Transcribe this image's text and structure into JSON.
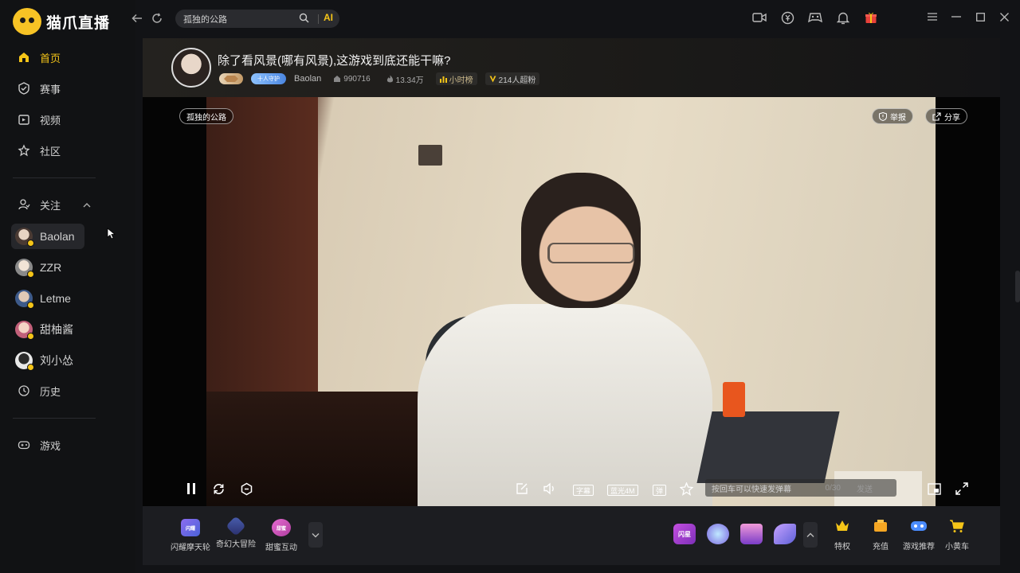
{
  "app": {
    "logo_text": "猫爪直播"
  },
  "sidebar": {
    "nav": [
      {
        "label": "首页",
        "icon": "home-icon",
        "active": true
      },
      {
        "label": "赛事",
        "icon": "trophy-icon",
        "active": false
      },
      {
        "label": "视频",
        "icon": "video-icon",
        "active": false
      },
      {
        "label": "社区",
        "icon": "community-icon",
        "active": false
      }
    ],
    "follow": {
      "label": "关注",
      "items": [
        {
          "name": "Baolan",
          "color": "#6b5a52"
        },
        {
          "name": "ZZR",
          "color": "#d8d8d8"
        },
        {
          "name": "Letme",
          "color": "#4f6e9c"
        },
        {
          "name": "甜柚酱",
          "color": "#d57b8c"
        },
        {
          "name": "刘小怂",
          "color": "#e0e0e0"
        }
      ]
    },
    "history": "历史",
    "games": "游戏"
  },
  "topbar": {
    "search_value": "孤独的公路",
    "ai_label": "AI"
  },
  "room": {
    "title": "除了看风景(哪有风景),这游戏到底还能干嘛?",
    "guard_badge": "十人守护",
    "streamer": "Baolan",
    "room_id": "990716",
    "heat": "13.34万",
    "rank_tag": "小时榜",
    "fans_tag": "214人超粉"
  },
  "video": {
    "game_chip": "孤独的公路",
    "report": "举报",
    "share": "分享",
    "subtitle_btn": "字幕",
    "quality_btn": "蓝光4M",
    "danmaku_btn": "弹",
    "danmaku_placeholder": "按回车可以快速发弹幕",
    "danmaku_count": "0/30",
    "send": "发送"
  },
  "bottombar": {
    "left": [
      {
        "label": "闪耀摩天轮",
        "icon_text": "闪耀摩天轮",
        "color": "#6a5bd8"
      },
      {
        "label": "奇幻大冒险",
        "icon_text": "大冒险",
        "color": "#3b4b8f"
      },
      {
        "label": "甜蜜互动",
        "icon_text": "甜蜜互动",
        "color": "#d65cb7"
      }
    ],
    "right": [
      {
        "label": "特权",
        "color": "#f5c518"
      },
      {
        "label": "充值",
        "color": "#f5a623"
      },
      {
        "label": "游戏推荐",
        "color": "#4a8cff"
      },
      {
        "label": "小黄车",
        "color": "#f5c518"
      }
    ],
    "gift_badge": "闪星"
  },
  "colors": {
    "accent": "#f5c518",
    "sidebar_bg": "#111214",
    "bottom_bg": "#1c1d21"
  }
}
